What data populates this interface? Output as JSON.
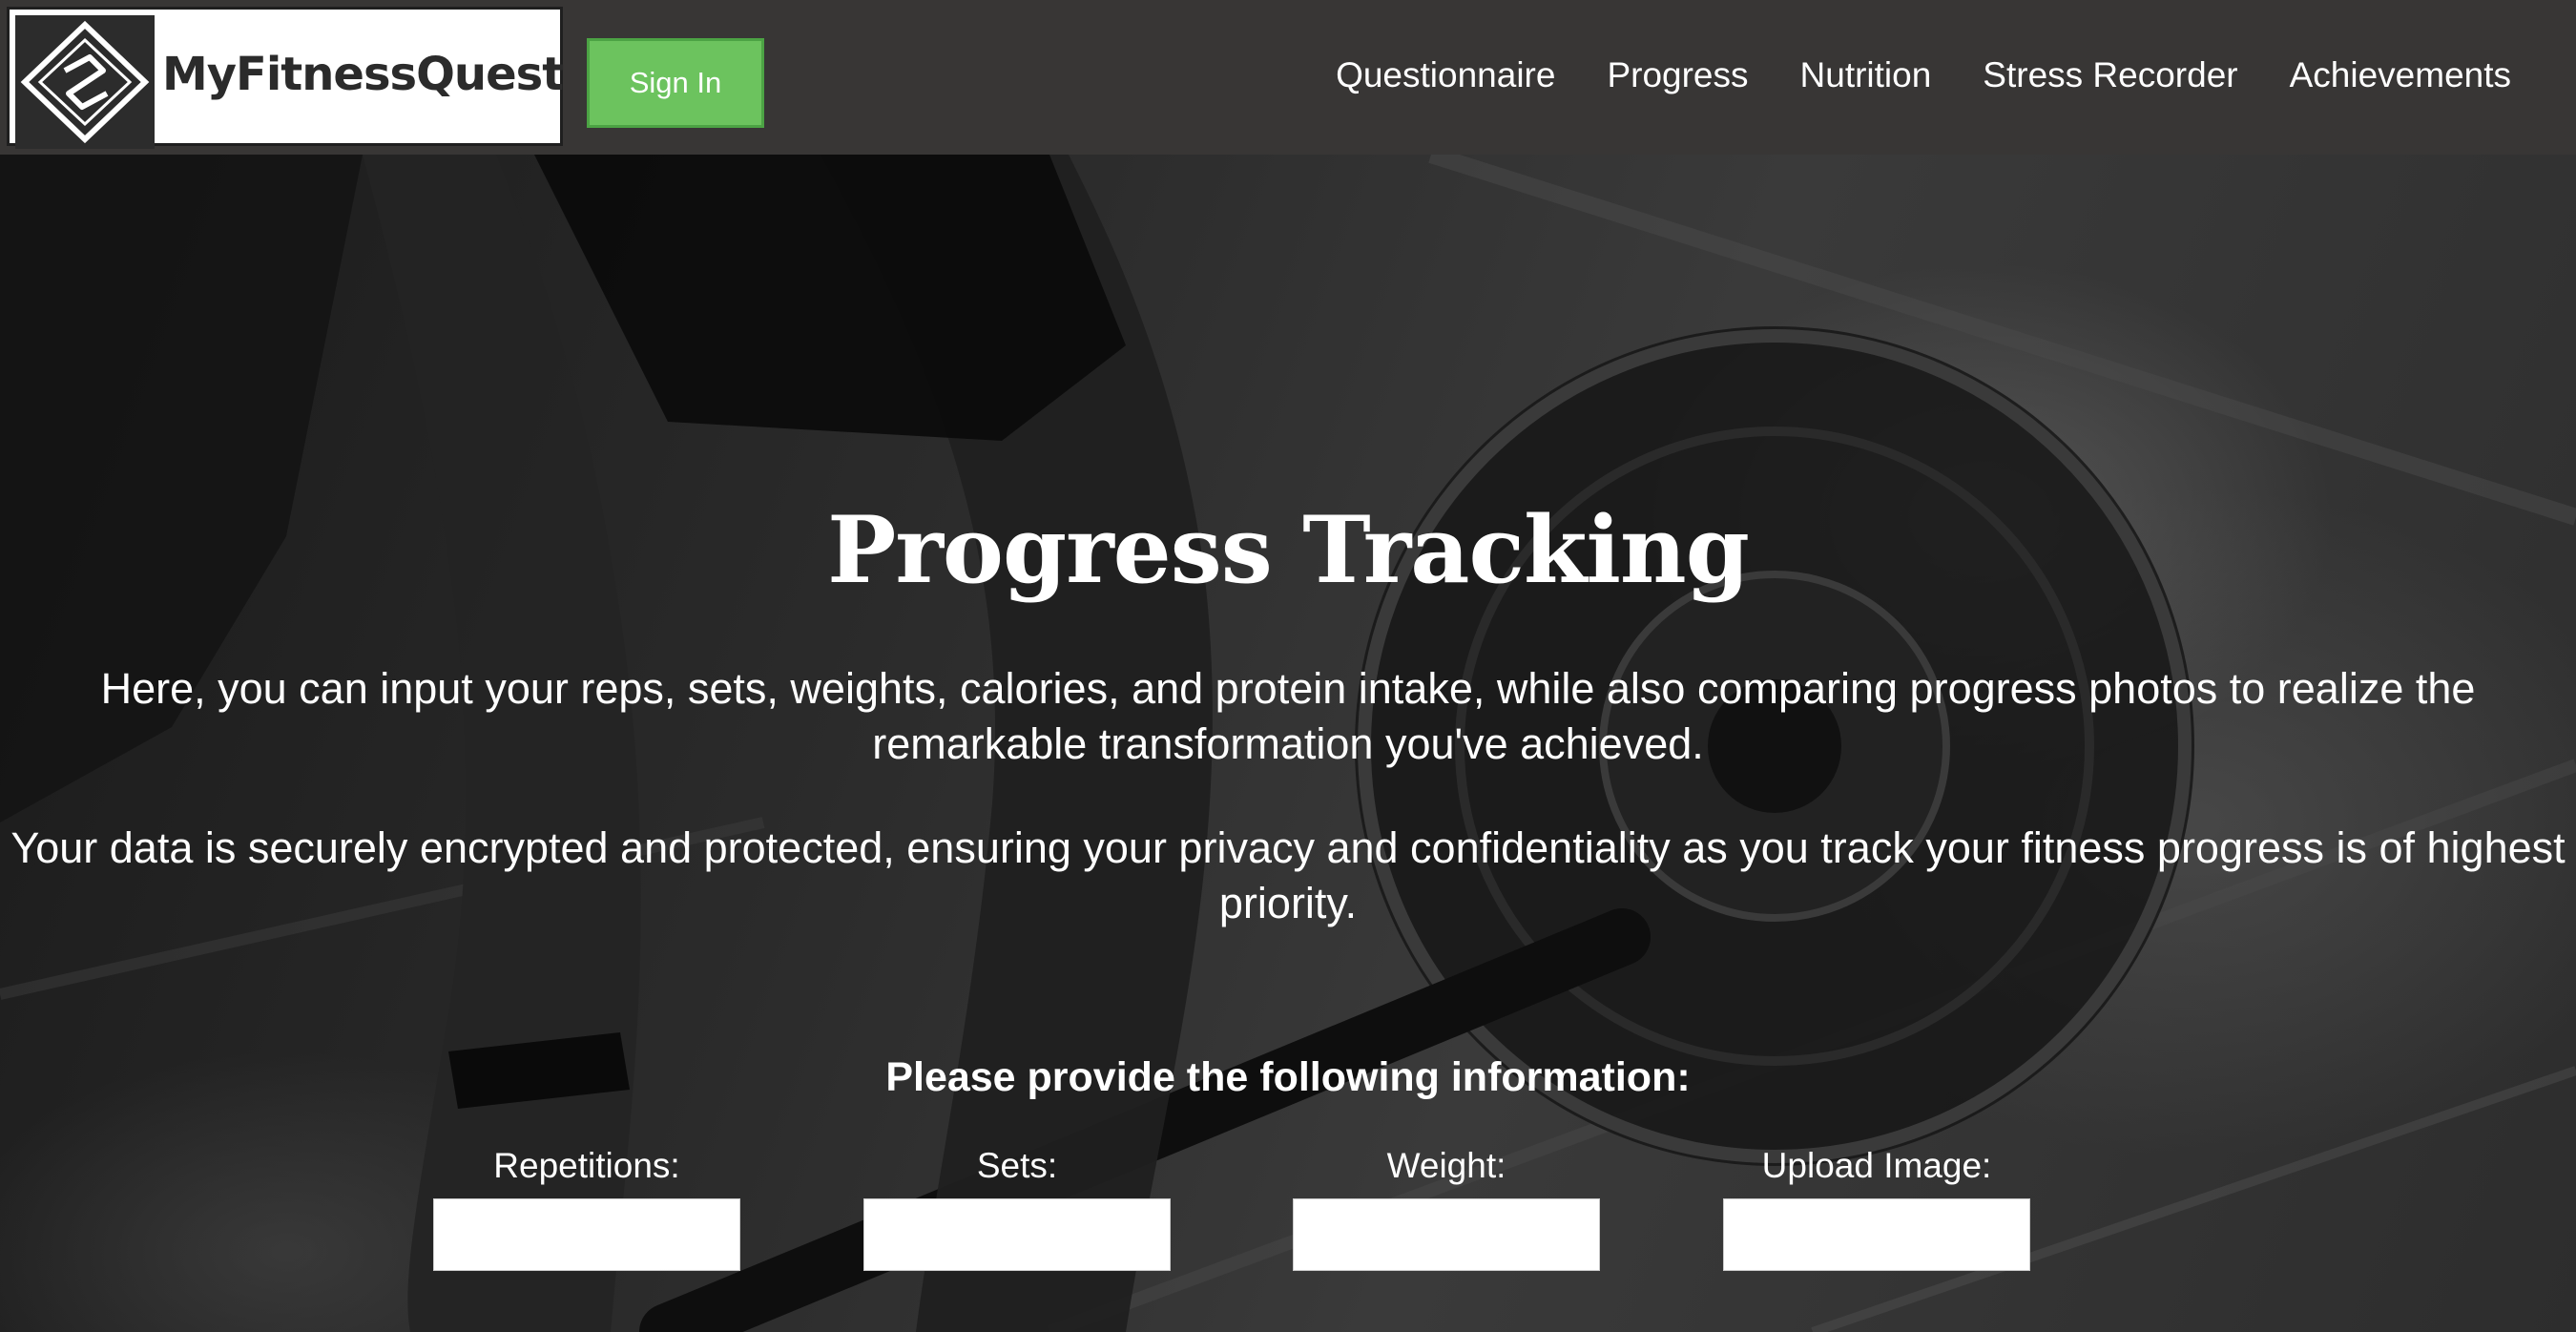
{
  "header": {
    "logo_text": "MyFitnessQuest",
    "sign_in_label": "Sign In",
    "nav": [
      {
        "label": "Questionnaire"
      },
      {
        "label": "Progress"
      },
      {
        "label": "Nutrition"
      },
      {
        "label": "Stress Recorder"
      },
      {
        "label": "Achievements"
      }
    ]
  },
  "main": {
    "title": "Progress Tracking",
    "intro": "Here, you can input your reps, sets, weights, calories, and protein intake, while also comparing progress photos to realize the remarkable transformation you've achieved.",
    "privacy": "Your data is securely encrypted and protected, ensuring your privacy and confidentiality as you track your fitness progress is of highest priority.",
    "form_prompt": "Please provide the following information:",
    "fields": [
      {
        "label": "Repetitions:",
        "value": ""
      },
      {
        "label": "Sets:",
        "value": ""
      },
      {
        "label": "Weight:",
        "value": ""
      },
      {
        "label": "Upload Image:",
        "value": ""
      }
    ]
  },
  "colors": {
    "header_bg": "#383635",
    "sign_in_bg": "#6cc35e",
    "text": "#ffffff"
  }
}
